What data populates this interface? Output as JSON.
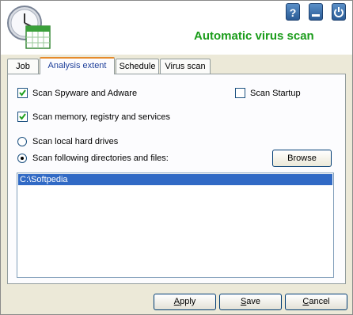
{
  "header": {
    "title": "Automatic virus scan",
    "logo_icon": "clock-calendar-icon",
    "help_label": "?",
    "title_color": "#1a9c1a"
  },
  "tabs": [
    {
      "label": "Job",
      "active": false
    },
    {
      "label": "Analysis extent",
      "active": true
    },
    {
      "label": "Schedule",
      "active": false
    },
    {
      "label": "Virus scan",
      "active": false
    }
  ],
  "options": {
    "scan_spyware": {
      "label": "Scan Spyware and Adware",
      "checked": true
    },
    "scan_startup": {
      "label": "Scan Startup",
      "checked": false
    },
    "scan_memory": {
      "label": "Scan memory, registry and services",
      "checked": true
    },
    "scan_local": {
      "label": "Scan local hard drives",
      "selected": false
    },
    "scan_dirs": {
      "label": "Scan following directories and files:",
      "selected": true
    }
  },
  "browse_label": "Browse",
  "directories": [
    "C:\\Softpedia"
  ],
  "footer": {
    "apply_key": "A",
    "apply_rest": "pply",
    "save_key": "S",
    "save_rest": "ave",
    "cancel_key": "C",
    "cancel_rest": "ancel"
  }
}
